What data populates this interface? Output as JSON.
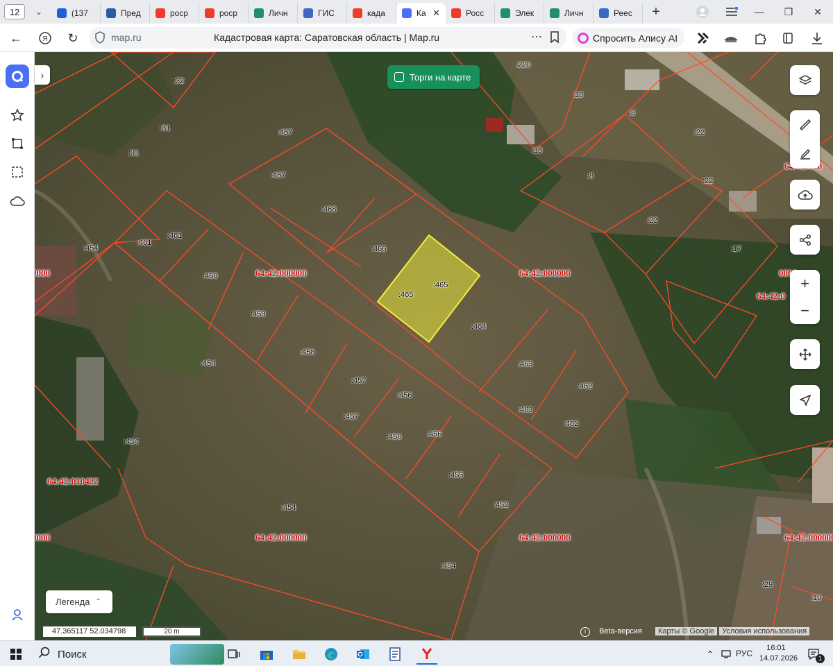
{
  "browser": {
    "tab_count": "12",
    "tabs": [
      {
        "label": "(137",
        "icon": "mail-icon",
        "color": "#1f5fd6"
      },
      {
        "label": "Пред",
        "icon": "gosuslugi-icon",
        "color": "#2a5aa8"
      },
      {
        "label": "роср",
        "icon": "yandex-icon",
        "color": "#f03a2a"
      },
      {
        "label": "роср",
        "icon": "yandex-icon",
        "color": "#f03a2a"
      },
      {
        "label": "Личн",
        "icon": "emblem-icon",
        "color": "#1f8f6a"
      },
      {
        "label": "ГИС",
        "icon": "eagle-icon",
        "color": "#3b66c4"
      },
      {
        "label": "када",
        "icon": "yandex-icon",
        "color": "#f03a2a"
      },
      {
        "label": "Ка",
        "icon": "mapru-icon",
        "color": "#4b6ff5",
        "active": true
      },
      {
        "label": "Росс",
        "icon": "yandex-icon",
        "color": "#f03a2a"
      },
      {
        "label": "Элек",
        "icon": "emblem-icon",
        "color": "#1f8f6a"
      },
      {
        "label": "Личн",
        "icon": "emblem-icon",
        "color": "#1f8f6a"
      },
      {
        "label": "Реес",
        "icon": "eagle-icon",
        "color": "#3b66c4"
      }
    ],
    "url_host": "map.ru",
    "page_title": "Кадастровая карта: Саратовская область | Map.ru",
    "alisa_label": "Спросить Алису AI"
  },
  "map": {
    "auction_label": "Торги на карте",
    "legend_label": "Легенда",
    "coordinates": "47.365117  52.034798",
    "scale_label": "20 m",
    "beta_label": "Beta-версия",
    "copyright": "Карты © Google",
    "terms": "Условия использования",
    "parcel_labels": [
      {
        "t": ":31"
      },
      {
        "t": ":32"
      },
      {
        "t": ":31"
      },
      {
        "t": ":31"
      },
      {
        "t": ":467"
      },
      {
        "t": ":467"
      },
      {
        "t": ":468"
      },
      {
        "t": ":466"
      },
      {
        "t": ":465"
      },
      {
        "t": ":465"
      },
      {
        "t": ":464"
      },
      {
        "t": ":461"
      },
      {
        "t": ":461"
      },
      {
        "t": ":454"
      },
      {
        "t": ":460"
      },
      {
        "t": ":459"
      },
      {
        "t": ":458"
      },
      {
        "t": ":457"
      },
      {
        "t": ":457"
      },
      {
        "t": ":456"
      },
      {
        "t": ":456"
      },
      {
        "t": ":456"
      },
      {
        "t": ":455"
      },
      {
        "t": ":454"
      },
      {
        "t": ":454"
      },
      {
        "t": ":454"
      },
      {
        "t": ":454"
      },
      {
        "t": ":452"
      },
      {
        "t": ":463"
      },
      {
        "t": ":463"
      },
      {
        "t": ":462"
      },
      {
        "t": ":462"
      },
      {
        "t": ":220"
      },
      {
        "t": ":18"
      },
      {
        "t": ":18"
      },
      {
        "t": ":8"
      },
      {
        "t": ":8"
      },
      {
        "t": ":22"
      },
      {
        "t": ":22"
      },
      {
        "t": ":22"
      },
      {
        "t": ":17"
      },
      {
        "t": ":29"
      },
      {
        "t": ":10"
      }
    ],
    "quarter_labels": [
      "64:42:000000",
      "64:42:000000",
      "0000",
      "64:42:010422",
      "64:42:000000",
      "64:42:000000",
      "0000",
      "64:42:010",
      "64:42:0",
      "64:42:000000",
      "0000"
    ]
  },
  "taskbar": {
    "search_label": "Поиск",
    "language": "РУС",
    "time": "16:01",
    "date": "14.07.2026",
    "notifications": "1"
  }
}
